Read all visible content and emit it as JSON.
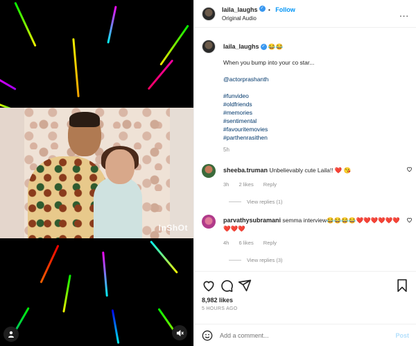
{
  "media": {
    "watermark": "InShOt"
  },
  "header": {
    "username": "laila_laughs",
    "follow_label": "Follow",
    "separator": "•",
    "audio": "Original Audio",
    "more_label": "..."
  },
  "caption": {
    "username": "laila_laughs",
    "emojis": "😂😂",
    "lines": [
      "When you bump into your co star...",
      "",
      "@actorprashanth",
      "",
      "#funvideo",
      "#oldfriends",
      "#memories",
      "#sentimental",
      "#favouritemovies",
      "#parthenrasithen"
    ],
    "time": "5h"
  },
  "comments": [
    {
      "username": "sheeba.truman",
      "text": "Unbelievably cute Laila!! ❤️ 😘",
      "time": "3h",
      "likes": "2 likes",
      "reply": "Reply",
      "view_replies": "View replies (1)"
    },
    {
      "username": "parvathysubramani",
      "text": "semma interview😂😂😂😂❤️❤️❤️❤️❤️❤️❤️❤️❤️",
      "time": "4h",
      "likes": "6 likes",
      "reply": "Reply",
      "view_replies": "View replies (3)"
    }
  ],
  "footer": {
    "likes": "8,982 likes",
    "posted": "5 HOURS AGO",
    "comment_placeholder": "Add a comment...",
    "post_label": "Post"
  },
  "colors": {
    "link": "#0095f6",
    "hashtag": "#00376b",
    "muted": "#8e8e8e"
  },
  "icons": [
    "verified-badge-icon",
    "more-options-icon",
    "heart-icon",
    "comment-icon",
    "share-icon",
    "bookmark-icon",
    "emoji-icon",
    "user-tag-icon",
    "mute-icon"
  ]
}
